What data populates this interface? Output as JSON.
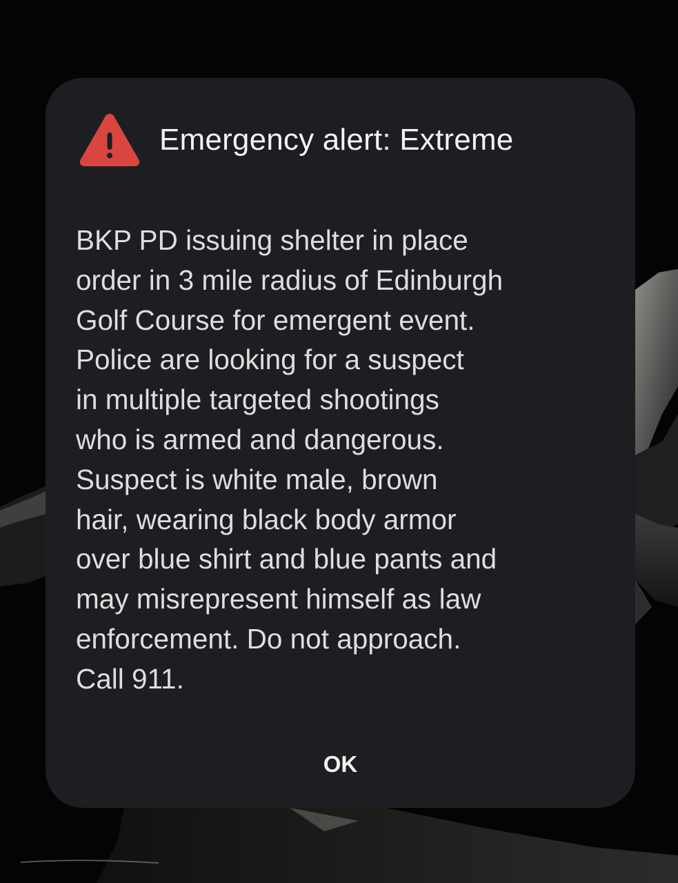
{
  "alert": {
    "title": "Emergency alert: Extreme",
    "icon": "warning-triangle-icon",
    "icon_color": "#d9463f",
    "message_lines": [
      "BKP PD issuing shelter in place",
      "order in 3 mile radius of Edinburgh",
      "Golf Course for emergent event.",
      "Police are looking for a suspect",
      "in multiple targeted shootings",
      "who is armed and dangerous.",
      "Suspect is white male, brown",
      "hair, wearing black body armor",
      "over blue shirt and blue pants and",
      "may misrepresent himself as law",
      "enforcement. Do not approach.",
      "Call 911."
    ],
    "ok_label": "OK"
  },
  "colors": {
    "dialog_background": "#1d1e22",
    "screen_background": "#040404",
    "title_text": "#f3f3f3",
    "body_text": "#dedede"
  }
}
